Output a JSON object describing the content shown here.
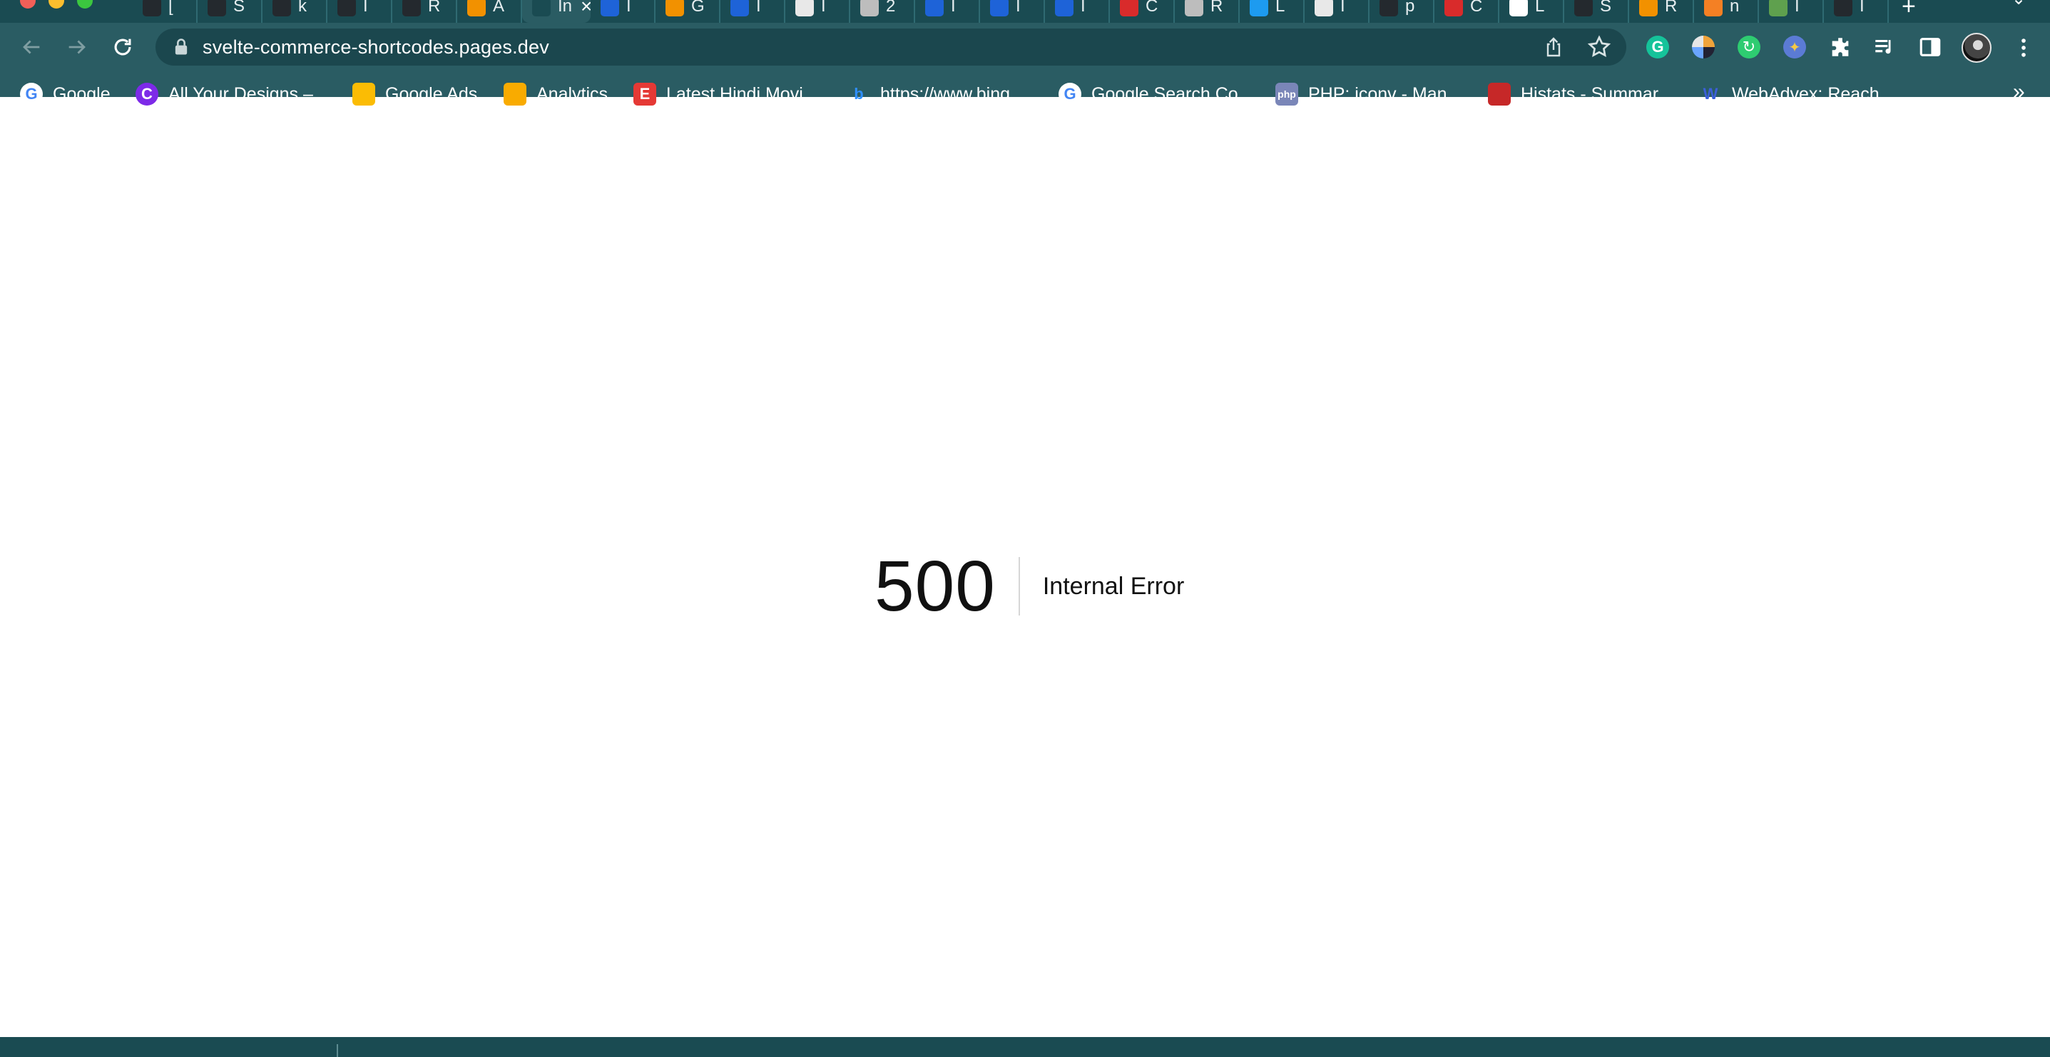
{
  "browser": {
    "tabs": [
      {
        "label": "[",
        "icon": "github-icon",
        "color": "#24292e"
      },
      {
        "label": "S",
        "icon": "github-icon",
        "color": "#24292e"
      },
      {
        "label": "k",
        "icon": "github-icon",
        "color": "#24292e"
      },
      {
        "label": "I",
        "icon": "github-icon",
        "color": "#24292e"
      },
      {
        "label": "R",
        "icon": "github-icon",
        "color": "#24292e"
      },
      {
        "label": "A",
        "icon": "aws-icon",
        "color": "#f29100"
      },
      {
        "label": "In",
        "icon": "page-icon",
        "color": "#1a4b52",
        "active": true
      },
      {
        "label": "I",
        "icon": "zeit-icon",
        "color": "#1e63d8"
      },
      {
        "label": "G",
        "icon": "aws-icon",
        "color": "#f29100"
      },
      {
        "label": "I",
        "icon": "zeit-icon",
        "color": "#1e63d8"
      },
      {
        "label": "I",
        "icon": "cloud-icon",
        "color": "#e8e8e8"
      },
      {
        "label": "2",
        "icon": "moon-icon",
        "color": "#bdbdbd"
      },
      {
        "label": "I",
        "icon": "zeit-icon",
        "color": "#1e63d8"
      },
      {
        "label": "I",
        "icon": "zeit-icon",
        "color": "#1e63d8"
      },
      {
        "label": "I",
        "icon": "zeit-icon",
        "color": "#1e63d8"
      },
      {
        "label": "C",
        "icon": "red-square-icon",
        "color": "#d92b2b"
      },
      {
        "label": "R",
        "icon": "moon-icon",
        "color": "#bdbdbd"
      },
      {
        "label": "L",
        "icon": "twitter-icon",
        "color": "#1d9bf0"
      },
      {
        "label": "I",
        "icon": "cloud-icon",
        "color": "#e8e8e8"
      },
      {
        "label": "p",
        "icon": "github-icon",
        "color": "#24292e"
      },
      {
        "label": "C",
        "icon": "red-square-icon",
        "color": "#d92b2b"
      },
      {
        "label": "L",
        "icon": "wp-icon",
        "color": "#ffffff"
      },
      {
        "label": "S",
        "icon": "github-icon",
        "color": "#24292e"
      },
      {
        "label": "R",
        "icon": "aws-icon",
        "color": "#f29100"
      },
      {
        "label": "n",
        "icon": "stack-icon",
        "color": "#f48024"
      },
      {
        "label": "I",
        "icon": "node-icon",
        "color": "#5fa04e"
      },
      {
        "label": "I",
        "icon": "github-icon",
        "color": "#24292e"
      }
    ],
    "address_bar": {
      "url": "svelte-commerce-shortcodes.pages.dev"
    },
    "extensions": [
      {
        "name": "grammarly-icon",
        "color": "#15c39a"
      },
      {
        "name": "color-picker-icon",
        "color": "#f0a33a"
      },
      {
        "name": "sync-extension-icon",
        "color": "#2ecc71"
      },
      {
        "name": "badge-extension-icon",
        "color": "#5b7bd5"
      }
    ],
    "bookmarks": [
      {
        "label": "Google",
        "icon": "google-icon",
        "color": "#ffffff"
      },
      {
        "label": "All Your Designs –...",
        "icon": "canva-icon",
        "color": "#7d2ae8"
      },
      {
        "label": "Google Ads",
        "icon": "google-ads-icon",
        "color": "#fbbc04"
      },
      {
        "label": "Analytics",
        "icon": "analytics-icon",
        "color": "#f9ab00"
      },
      {
        "label": "Latest Hindi Movi...",
        "icon": "e-icon",
        "color": "#e53935"
      },
      {
        "label": "https://www.bing....",
        "icon": "bing-icon",
        "color": "#2f8fff"
      },
      {
        "label": "Google Search Co...",
        "icon": "google-icon",
        "color": "#ffffff"
      },
      {
        "label": "PHP: iconv - Man...",
        "icon": "php-icon",
        "color": "#7a86b8"
      },
      {
        "label": "Histats - Summar...",
        "icon": "histats-icon",
        "color": "#c62828"
      },
      {
        "label": "WebAdvex: Reach...",
        "icon": "webadvex-icon",
        "color": "#3b5fd9"
      }
    ],
    "overflow_label": "»"
  },
  "page": {
    "error_code": "500",
    "error_message": "Internal Error"
  }
}
